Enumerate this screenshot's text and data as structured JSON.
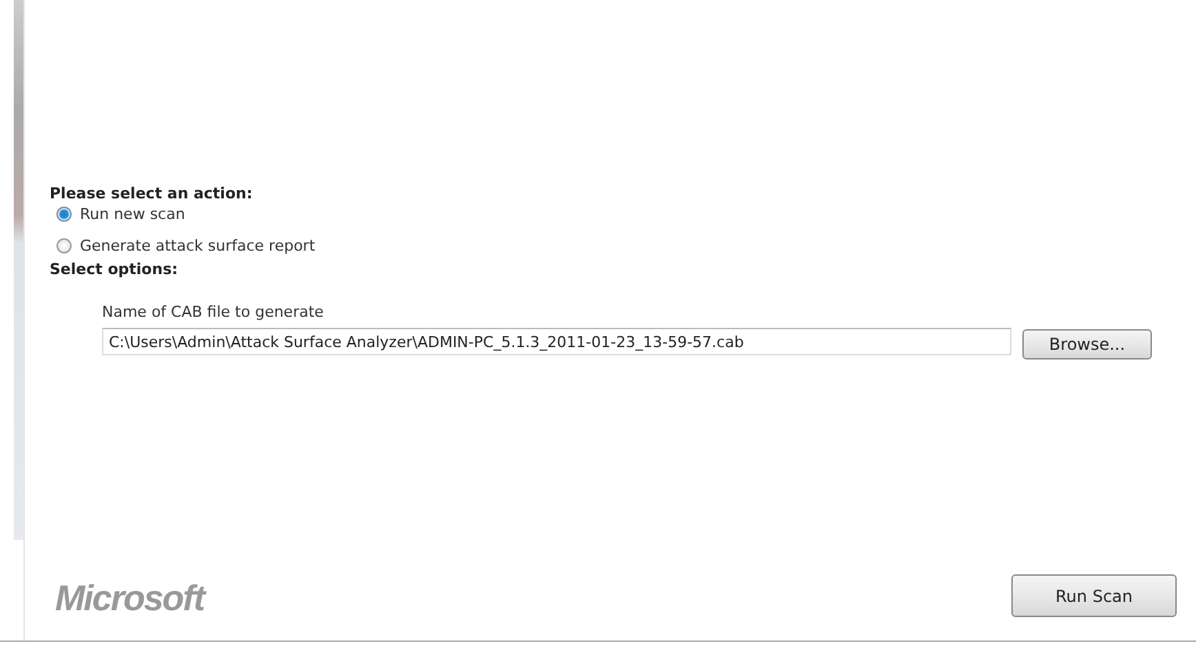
{
  "action_heading": "Please select an action:",
  "actions": [
    {
      "label": "Run new scan",
      "selected": true
    },
    {
      "label": "Generate attack surface report",
      "selected": false
    }
  ],
  "options_heading": "Select options:",
  "cab_file": {
    "label": "Name of CAB file to generate",
    "value": "C:\\Users\\Admin\\Attack Surface Analyzer\\ADMIN-PC_5.1.3_2011-01-23_13-59-57.cab",
    "browse_button": "Browse..."
  },
  "footer": {
    "logo": "Microsoft",
    "run_button": "Run Scan"
  }
}
